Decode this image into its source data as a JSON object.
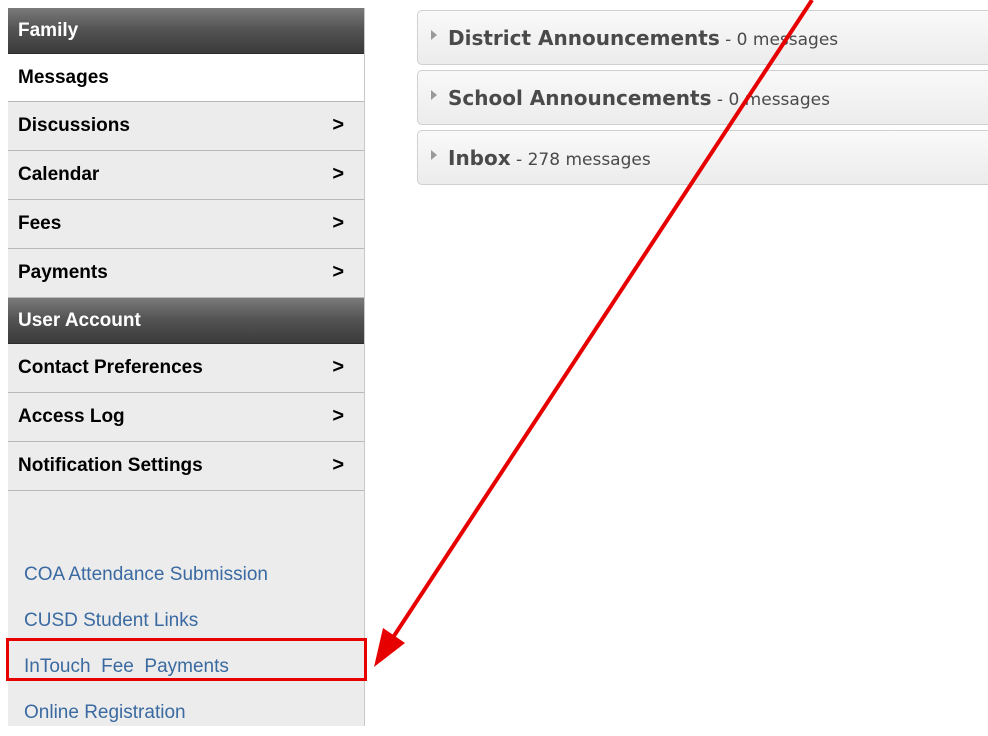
{
  "sidebar": {
    "family_header": "Family",
    "family_items": [
      {
        "label": "Messages",
        "chevron": ""
      },
      {
        "label": "Discussions",
        "chevron": ">"
      },
      {
        "label": "Calendar",
        "chevron": ">"
      },
      {
        "label": "Fees",
        "chevron": ">"
      },
      {
        "label": "Payments",
        "chevron": ">"
      }
    ],
    "account_header": "User Account",
    "account_items": [
      {
        "label": "Contact Preferences",
        "chevron": ">"
      },
      {
        "label": "Access Log",
        "chevron": ">"
      },
      {
        "label": "Notification Settings",
        "chevron": ">"
      }
    ],
    "links": [
      "COA Attendance Submission",
      "CUSD Student Links",
      "InTouch  Fee  Payments",
      "Online Registration"
    ]
  },
  "messages": [
    {
      "title": "District Announcements",
      "sep": " - ",
      "count": "0 messages"
    },
    {
      "title": "School Announcements",
      "sep": " - ",
      "count": "0 messages"
    },
    {
      "title": "Inbox",
      "sep": " - ",
      "count": "278 messages"
    }
  ],
  "annotation": {
    "color": "#e60000"
  }
}
